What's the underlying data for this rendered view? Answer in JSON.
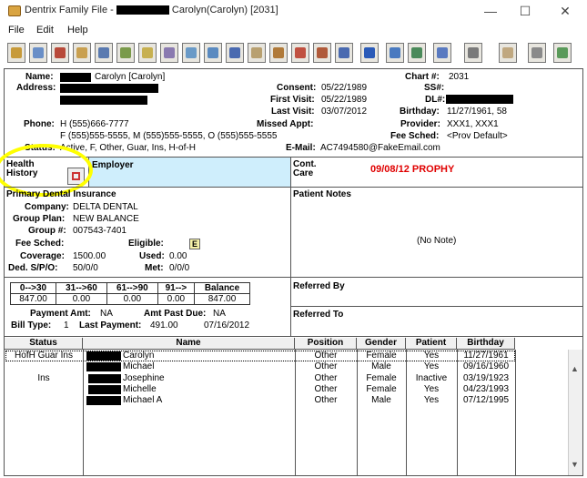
{
  "window": {
    "title_prefix": "Dentrix Family File -",
    "title_suffix": "Carolyn(Carolyn) [2031]",
    "minimize": "—",
    "maximize": "☐",
    "close": "✕"
  },
  "menu": [
    "File",
    "Edit",
    "Help"
  ],
  "patient": {
    "name_label": "Name:",
    "name_value": "Carolyn [Carolyn]",
    "address_label": "Address:",
    "phone_label": "Phone:",
    "phone_value": "H (555)666-7777",
    "phone_line2": "F (555)555-5555, M (555)555-5555, O (555)555-5555",
    "status_label": "Status:",
    "status_value": "Active, F, Other, Guar, Ins, H-of-H",
    "consent_label": "Consent:",
    "consent_value": "05/22/1989",
    "first_visit_label": "First Visit:",
    "first_visit_value": "05/22/1989",
    "last_visit_label": "Last Visit:",
    "last_visit_value": "03/07/2012",
    "missed_label": "Missed Appt:",
    "email_label": "E-Mail:",
    "email_value": "AC7494580@FakeEmail.com",
    "chart_label": "Chart #:",
    "chart_value": "2031",
    "ss_label": "SS#:",
    "dl_label": "DL#:",
    "birthday_label": "Birthday:",
    "birthday_value": "11/27/1961, 58",
    "provider_label": "Provider:",
    "provider_value": "XXX1, XXX1",
    "fee_label": "Fee Sched:",
    "fee_value": "<Prov Default>"
  },
  "health": {
    "label": "Health History",
    "employer_label": "Employer",
    "cont_care_label": "Cont. Care",
    "cont_care_value": "09/08/12 PROPHY",
    "cont_care_color": "#e00000"
  },
  "insurance": {
    "header": "Primary Dental Insurance",
    "company_label": "Company:",
    "company_value": "DELTA DENTAL",
    "group_plan_label": "Group Plan:",
    "group_plan_value": "NEW BALANCE",
    "group_no_label": "Group #:",
    "group_no_value": "007543-7401",
    "fee_label": "Fee Sched:",
    "eligible_label": "Eligible:",
    "eligible_badge": "E",
    "coverage_label": "Coverage:",
    "coverage_value": "1500.00",
    "used_label": "Used:",
    "used_value": "0.00",
    "ded_label": "Ded. S/P/O:",
    "ded_value": "50/0/0",
    "met_label": "Met:",
    "met_value": "0/0/0"
  },
  "notes": {
    "header": "Patient Notes",
    "empty": "(No Note)",
    "referred_by": "Referred By",
    "referred_to": "Referred To"
  },
  "aging": {
    "headers": [
      "0-->30",
      "31-->60",
      "61-->90",
      "91-->",
      "Balance"
    ],
    "values": [
      "847.00",
      "0.00",
      "0.00",
      "0.00",
      "847.00"
    ],
    "payment_amt_label": "Payment Amt:",
    "payment_amt_value": "NA",
    "amt_past_due_label": "Amt Past Due:",
    "amt_past_due_value": "NA",
    "bill_type_label": "Bill Type:",
    "bill_type_value": "1",
    "last_payment_label": "Last Payment:",
    "last_payment_value": "491.00",
    "last_payment_date": "07/16/2012"
  },
  "family": {
    "headers": [
      "Status",
      "Name",
      "Position",
      "Gender",
      "Patient",
      "Birthday"
    ],
    "rows": [
      {
        "status": "HofH Guar Ins",
        "name": "Carolyn",
        "position": "Other",
        "gender": "Female",
        "patient": "Yes",
        "birthday": "11/27/1961"
      },
      {
        "status": "",
        "name": "Michael",
        "position": "Other",
        "gender": "Male",
        "patient": "Yes",
        "birthday": "09/16/1960"
      },
      {
        "status": "Ins",
        "name": "Josephine",
        "position": "Other",
        "gender": "Female",
        "patient": "Inactive",
        "birthday": "03/19/1923"
      },
      {
        "status": "",
        "name": "Michelle",
        "position": "Other",
        "gender": "Female",
        "patient": "Yes",
        "birthday": "04/23/1993"
      },
      {
        "status": "",
        "name": "Michael A",
        "position": "Other",
        "gender": "Male",
        "patient": "Yes",
        "birthday": "07/12/1995"
      }
    ]
  },
  "toolbar_icons": [
    "family-file-icon",
    "patient-chart-icon",
    "ledger-icon",
    "perio-icon",
    "treatment-planner-icon",
    "office-journal-icon",
    "document-center-icon",
    "letters-icon",
    "quick-labels-icon",
    "email-icon",
    "continuing-care-icon",
    "prescriptions-icon",
    "referrals-icon",
    "medical-alerts-icon",
    "lab-case-icon",
    "questionnaire-icon",
    "info-icon",
    "add-family-member-icon",
    "move-family-member-icon",
    "merge-patients-icon",
    "print-icon",
    "picture-icon",
    "documents-icon",
    "patient-info-icon"
  ]
}
